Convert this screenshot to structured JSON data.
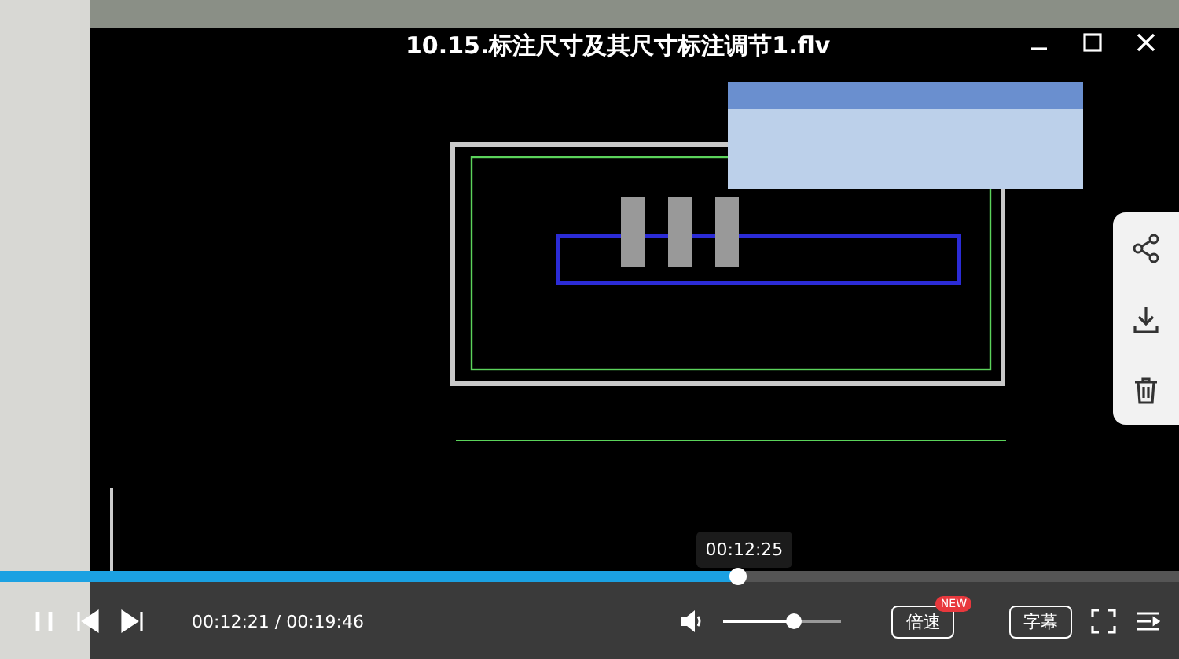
{
  "title": "10.15.标注尺寸及其尺寸标注调节1.flv",
  "progress": {
    "level": 0.625,
    "tooltip": "00:12:25"
  },
  "controls": {
    "playing": true,
    "time": "00:12:21 / 00:19:46",
    "volume": {
      "muted": false,
      "level": 0.6
    },
    "speed_button": {
      "label": "倍速",
      "badge": "NEW"
    },
    "subtitle_button": {
      "label": "字幕"
    }
  }
}
